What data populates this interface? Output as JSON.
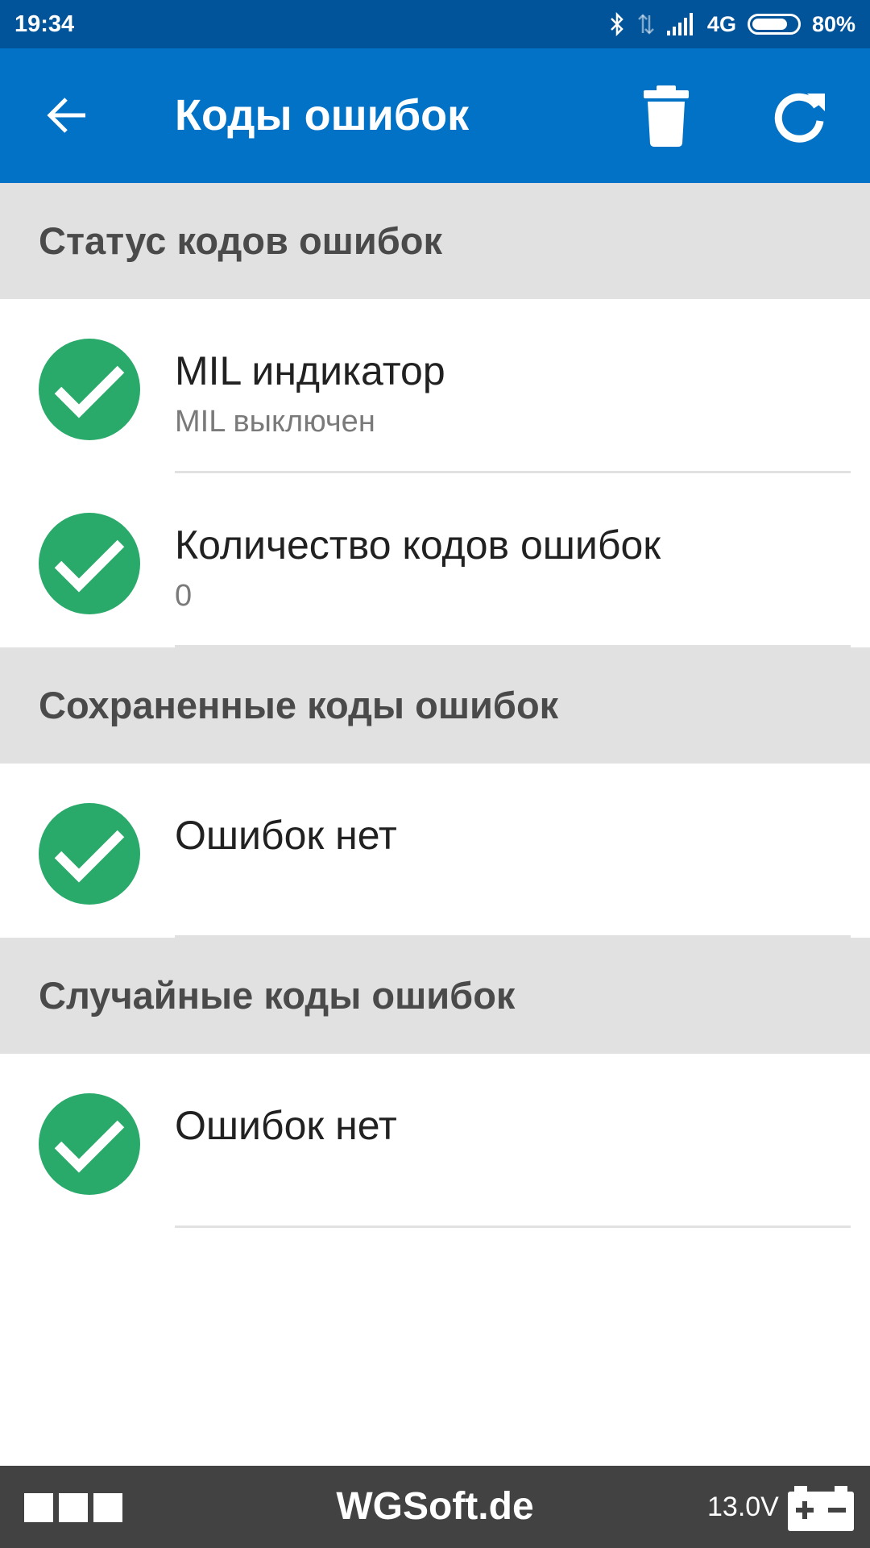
{
  "status_bar": {
    "time": "19:34",
    "network": "4G",
    "battery": "80%",
    "battery_level": 0.8
  },
  "app_bar": {
    "title": "Коды ошибок",
    "back_icon": "arrow-back-icon",
    "delete_icon": "trash-icon",
    "refresh_icon": "refresh-icon"
  },
  "sections": [
    {
      "header": "Статус кодов ошибок",
      "items": [
        {
          "title": "MIL индикатор",
          "subtitle": "MIL выключен",
          "icon": "check-circle-icon"
        },
        {
          "title": "Количество кодов ошибок",
          "subtitle": "0",
          "icon": "check-circle-icon"
        }
      ]
    },
    {
      "header": "Сохраненные коды ошибок",
      "items": [
        {
          "title": "Ошибок нет",
          "icon": "check-circle-icon"
        }
      ]
    },
    {
      "header": "Случайные коды ошибок",
      "items": [
        {
          "title": "Ошибок нет",
          "icon": "check-circle-icon"
        }
      ]
    }
  ],
  "bottom_bar": {
    "brand": "WGSoft.de",
    "voltage": "13.0V",
    "battery_icon": "car-battery-icon"
  },
  "colors": {
    "status_bar": "#02549a",
    "app_bar": "#0272c6",
    "section_header_bg": "#e1e1e1",
    "check_green": "#2aaa6a",
    "bottom_bar": "#424242"
  }
}
